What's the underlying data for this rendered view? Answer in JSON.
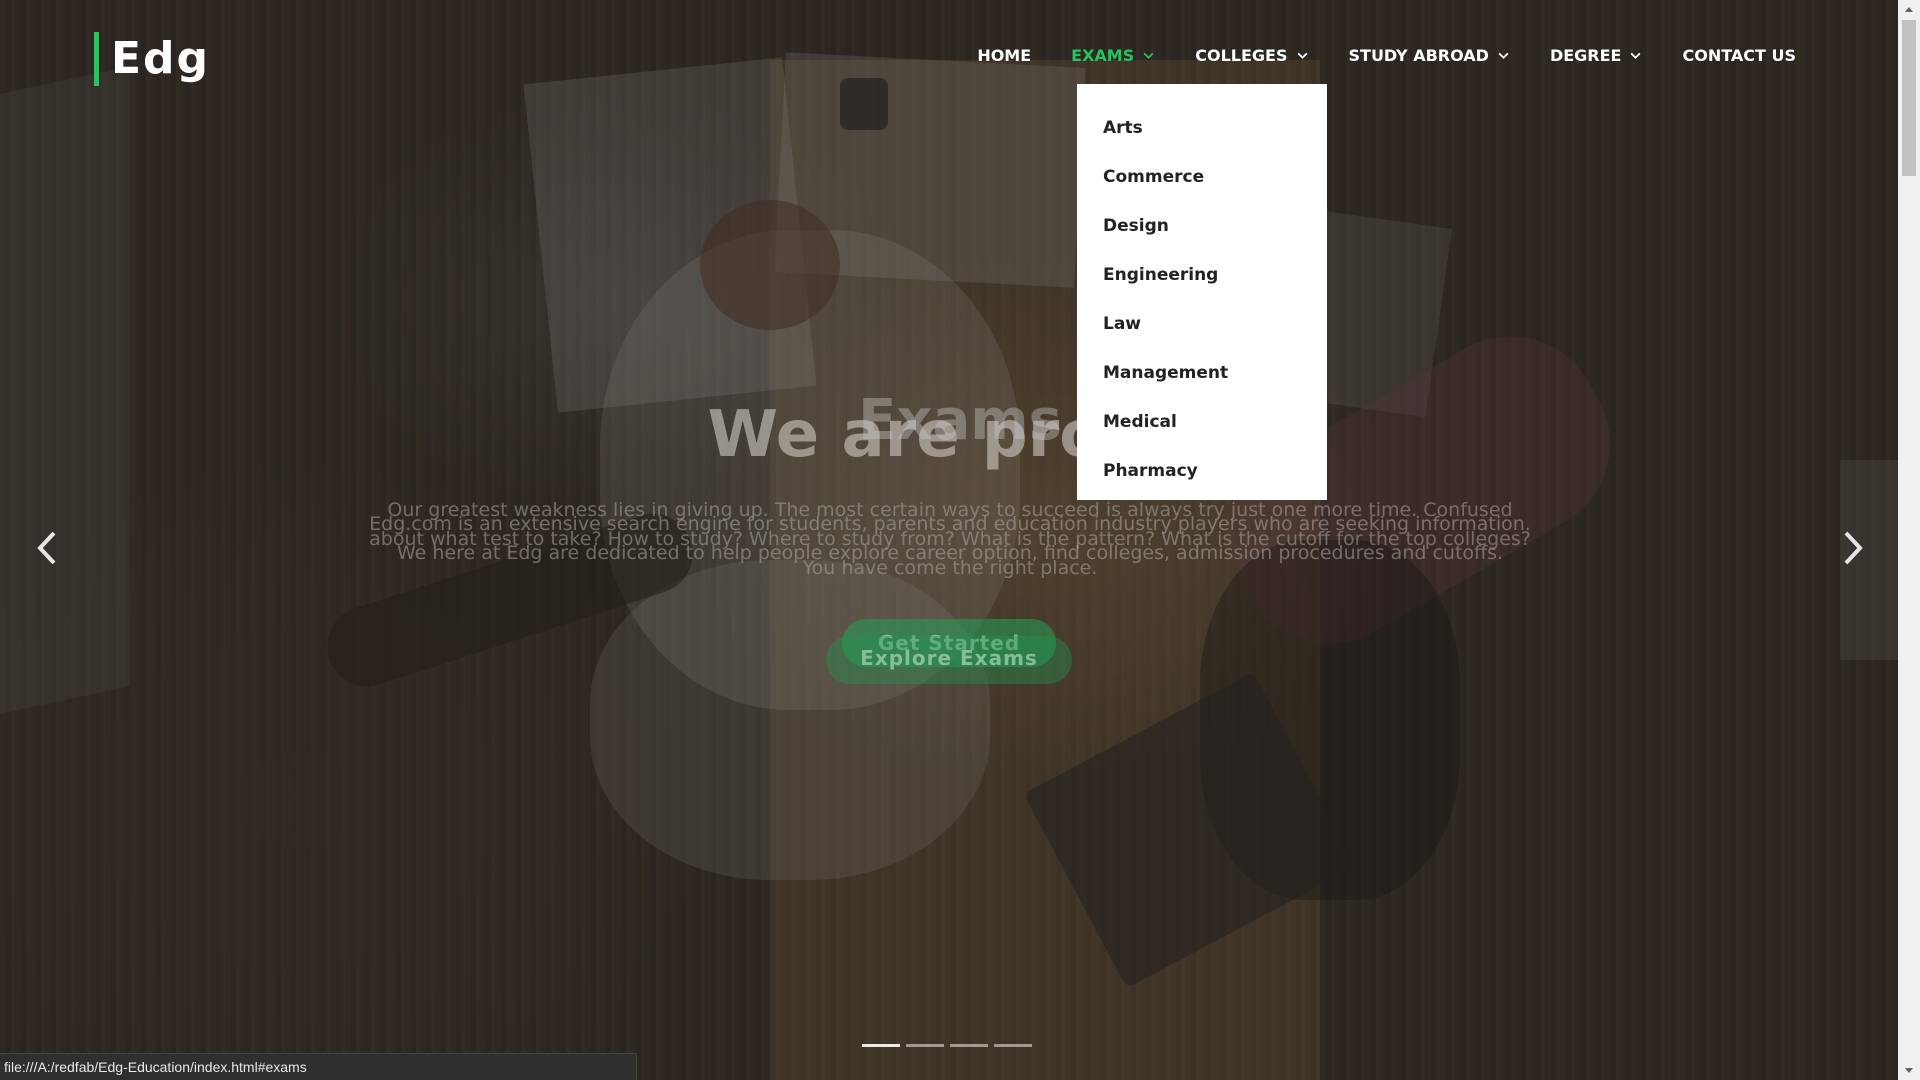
{
  "brand": {
    "logo_text": "Edg",
    "accent_color": "#22c55e"
  },
  "nav": {
    "items": [
      {
        "label": "HOME",
        "has_dropdown": false,
        "active": false
      },
      {
        "label": "EXAMS",
        "has_dropdown": true,
        "active": true
      },
      {
        "label": "COLLEGES",
        "has_dropdown": true,
        "active": false
      },
      {
        "label": "STUDY ABROAD",
        "has_dropdown": true,
        "active": false
      },
      {
        "label": "DEGREE",
        "has_dropdown": true,
        "active": false
      },
      {
        "label": "CONTACT US",
        "has_dropdown": false,
        "active": false
      }
    ],
    "dropdown_icon": "chevron-down-icon"
  },
  "exams_dropdown": {
    "items": [
      "Arts",
      "Commerce",
      "Design",
      "Engineering",
      "Law",
      "Management",
      "Medical",
      "Pharmacy"
    ]
  },
  "hero": {
    "slide_a": {
      "title": "We are profes",
      "paragraph": "Edg.com is an extensive search engine for students, parents and education industry players who are seeking information. We here at Edg are dedicated to help people explore career option, find colleges, admission procedures and cutoffs.",
      "button_label": "Get Started"
    },
    "slide_b": {
      "title": "Exams",
      "paragraph_start": "Our greatest weakness lies in giving up. The most certain ways to succeed is always try just one more time. Confused about what test to take? How to study? Where to study from? What is the pattern? What is the ",
      "paragraph_highlight": "cutoff for the top colleges?",
      "paragraph_end": " You have come the right place.",
      "button_label": "Explore Exams"
    },
    "prev_icon": "chevron-left-icon",
    "next_icon": "chevron-right-icon",
    "indicators": {
      "count": 4,
      "active_index": 0
    }
  },
  "status_bar": {
    "url": "file:///A:/redfab/Edg-Education/index.html#exams"
  }
}
